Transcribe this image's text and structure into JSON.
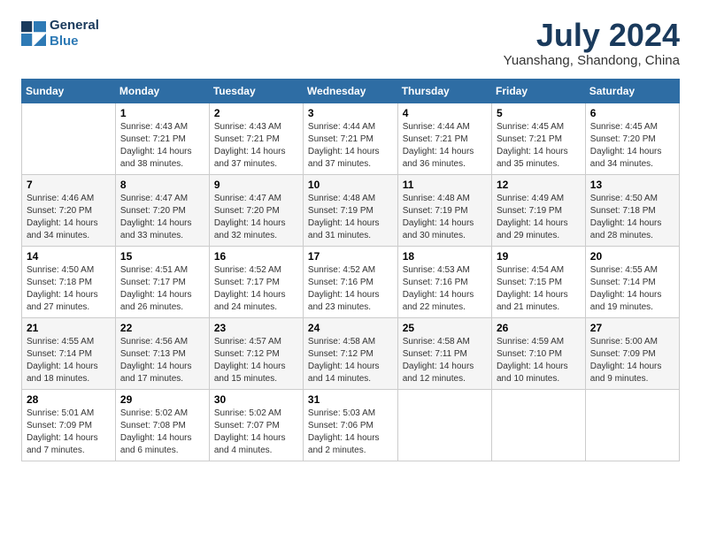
{
  "header": {
    "logo_line1": "General",
    "logo_line2": "Blue",
    "month_title": "July 2024",
    "subtitle": "Yuanshang, Shandong, China"
  },
  "weekdays": [
    "Sunday",
    "Monday",
    "Tuesday",
    "Wednesday",
    "Thursday",
    "Friday",
    "Saturday"
  ],
  "weeks": [
    [
      {
        "day": "",
        "sunrise": "",
        "sunset": "",
        "daylight": ""
      },
      {
        "day": "1",
        "sunrise": "Sunrise: 4:43 AM",
        "sunset": "Sunset: 7:21 PM",
        "daylight": "Daylight: 14 hours and 38 minutes."
      },
      {
        "day": "2",
        "sunrise": "Sunrise: 4:43 AM",
        "sunset": "Sunset: 7:21 PM",
        "daylight": "Daylight: 14 hours and 37 minutes."
      },
      {
        "day": "3",
        "sunrise": "Sunrise: 4:44 AM",
        "sunset": "Sunset: 7:21 PM",
        "daylight": "Daylight: 14 hours and 37 minutes."
      },
      {
        "day": "4",
        "sunrise": "Sunrise: 4:44 AM",
        "sunset": "Sunset: 7:21 PM",
        "daylight": "Daylight: 14 hours and 36 minutes."
      },
      {
        "day": "5",
        "sunrise": "Sunrise: 4:45 AM",
        "sunset": "Sunset: 7:21 PM",
        "daylight": "Daylight: 14 hours and 35 minutes."
      },
      {
        "day": "6",
        "sunrise": "Sunrise: 4:45 AM",
        "sunset": "Sunset: 7:20 PM",
        "daylight": "Daylight: 14 hours and 34 minutes."
      }
    ],
    [
      {
        "day": "7",
        "sunrise": "Sunrise: 4:46 AM",
        "sunset": "Sunset: 7:20 PM",
        "daylight": "Daylight: 14 hours and 34 minutes."
      },
      {
        "day": "8",
        "sunrise": "Sunrise: 4:47 AM",
        "sunset": "Sunset: 7:20 PM",
        "daylight": "Daylight: 14 hours and 33 minutes."
      },
      {
        "day": "9",
        "sunrise": "Sunrise: 4:47 AM",
        "sunset": "Sunset: 7:20 PM",
        "daylight": "Daylight: 14 hours and 32 minutes."
      },
      {
        "day": "10",
        "sunrise": "Sunrise: 4:48 AM",
        "sunset": "Sunset: 7:19 PM",
        "daylight": "Daylight: 14 hours and 31 minutes."
      },
      {
        "day": "11",
        "sunrise": "Sunrise: 4:48 AM",
        "sunset": "Sunset: 7:19 PM",
        "daylight": "Daylight: 14 hours and 30 minutes."
      },
      {
        "day": "12",
        "sunrise": "Sunrise: 4:49 AM",
        "sunset": "Sunset: 7:19 PM",
        "daylight": "Daylight: 14 hours and 29 minutes."
      },
      {
        "day": "13",
        "sunrise": "Sunrise: 4:50 AM",
        "sunset": "Sunset: 7:18 PM",
        "daylight": "Daylight: 14 hours and 28 minutes."
      }
    ],
    [
      {
        "day": "14",
        "sunrise": "Sunrise: 4:50 AM",
        "sunset": "Sunset: 7:18 PM",
        "daylight": "Daylight: 14 hours and 27 minutes."
      },
      {
        "day": "15",
        "sunrise": "Sunrise: 4:51 AM",
        "sunset": "Sunset: 7:17 PM",
        "daylight": "Daylight: 14 hours and 26 minutes."
      },
      {
        "day": "16",
        "sunrise": "Sunrise: 4:52 AM",
        "sunset": "Sunset: 7:17 PM",
        "daylight": "Daylight: 14 hours and 24 minutes."
      },
      {
        "day": "17",
        "sunrise": "Sunrise: 4:52 AM",
        "sunset": "Sunset: 7:16 PM",
        "daylight": "Daylight: 14 hours and 23 minutes."
      },
      {
        "day": "18",
        "sunrise": "Sunrise: 4:53 AM",
        "sunset": "Sunset: 7:16 PM",
        "daylight": "Daylight: 14 hours and 22 minutes."
      },
      {
        "day": "19",
        "sunrise": "Sunrise: 4:54 AM",
        "sunset": "Sunset: 7:15 PM",
        "daylight": "Daylight: 14 hours and 21 minutes."
      },
      {
        "day": "20",
        "sunrise": "Sunrise: 4:55 AM",
        "sunset": "Sunset: 7:14 PM",
        "daylight": "Daylight: 14 hours and 19 minutes."
      }
    ],
    [
      {
        "day": "21",
        "sunrise": "Sunrise: 4:55 AM",
        "sunset": "Sunset: 7:14 PM",
        "daylight": "Daylight: 14 hours and 18 minutes."
      },
      {
        "day": "22",
        "sunrise": "Sunrise: 4:56 AM",
        "sunset": "Sunset: 7:13 PM",
        "daylight": "Daylight: 14 hours and 17 minutes."
      },
      {
        "day": "23",
        "sunrise": "Sunrise: 4:57 AM",
        "sunset": "Sunset: 7:12 PM",
        "daylight": "Daylight: 14 hours and 15 minutes."
      },
      {
        "day": "24",
        "sunrise": "Sunrise: 4:58 AM",
        "sunset": "Sunset: 7:12 PM",
        "daylight": "Daylight: 14 hours and 14 minutes."
      },
      {
        "day": "25",
        "sunrise": "Sunrise: 4:58 AM",
        "sunset": "Sunset: 7:11 PM",
        "daylight": "Daylight: 14 hours and 12 minutes."
      },
      {
        "day": "26",
        "sunrise": "Sunrise: 4:59 AM",
        "sunset": "Sunset: 7:10 PM",
        "daylight": "Daylight: 14 hours and 10 minutes."
      },
      {
        "day": "27",
        "sunrise": "Sunrise: 5:00 AM",
        "sunset": "Sunset: 7:09 PM",
        "daylight": "Daylight: 14 hours and 9 minutes."
      }
    ],
    [
      {
        "day": "28",
        "sunrise": "Sunrise: 5:01 AM",
        "sunset": "Sunset: 7:09 PM",
        "daylight": "Daylight: 14 hours and 7 minutes."
      },
      {
        "day": "29",
        "sunrise": "Sunrise: 5:02 AM",
        "sunset": "Sunset: 7:08 PM",
        "daylight": "Daylight: 14 hours and 6 minutes."
      },
      {
        "day": "30",
        "sunrise": "Sunrise: 5:02 AM",
        "sunset": "Sunset: 7:07 PM",
        "daylight": "Daylight: 14 hours and 4 minutes."
      },
      {
        "day": "31",
        "sunrise": "Sunrise: 5:03 AM",
        "sunset": "Sunset: 7:06 PM",
        "daylight": "Daylight: 14 hours and 2 minutes."
      },
      {
        "day": "",
        "sunrise": "",
        "sunset": "",
        "daylight": ""
      },
      {
        "day": "",
        "sunrise": "",
        "sunset": "",
        "daylight": ""
      },
      {
        "day": "",
        "sunrise": "",
        "sunset": "",
        "daylight": ""
      }
    ]
  ]
}
